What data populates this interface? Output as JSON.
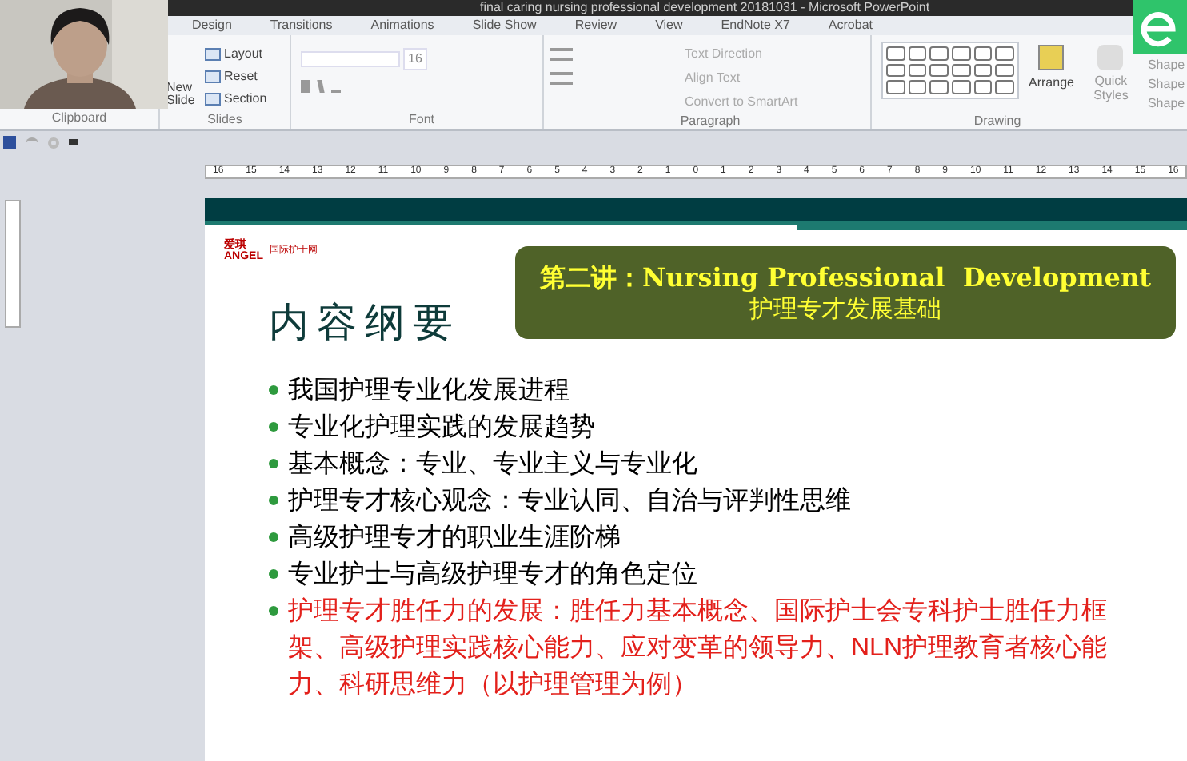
{
  "window": {
    "title": "final caring nursing professional development 20181031 - Microsoft PowerPoint"
  },
  "tabs": [
    {
      "label": "Design",
      "selected": false
    },
    {
      "label": "Transitions",
      "selected": false
    },
    {
      "label": "Animations",
      "selected": false
    },
    {
      "label": "Slide Show",
      "selected": false
    },
    {
      "label": "Review",
      "selected": false
    },
    {
      "label": "View",
      "selected": false
    },
    {
      "label": "EndNote X7",
      "selected": false
    },
    {
      "label": "Acrobat",
      "selected": false
    }
  ],
  "ribbon": {
    "groups": [
      "Clipboard",
      "Slides",
      "Font",
      "Paragraph",
      "Drawing"
    ],
    "slides_buttons": [
      "New Slide",
      "Layout",
      "Reset",
      "Section"
    ],
    "font_size": "16",
    "paragraph_buttons": [
      "Text Direction",
      "Align Text",
      "Convert to SmartArt"
    ],
    "drawing_buttons": [
      "Arrange",
      "Quick Styles",
      "Shape",
      "Shape",
      "Shape"
    ]
  },
  "ruler": [
    "16",
    "15",
    "14",
    "13",
    "12",
    "11",
    "10",
    "9",
    "8",
    "7",
    "6",
    "5",
    "4",
    "3",
    "2",
    "1",
    "0",
    "1",
    "2",
    "3",
    "4",
    "5",
    "6",
    "7",
    "8",
    "9",
    "10",
    "11",
    "12",
    "13",
    "14",
    "15",
    "16"
  ],
  "slide": {
    "logos": [
      "爱琪",
      "ANGEL",
      "国际护士网"
    ],
    "banner": {
      "line1": "第二讲：Nursing Professional  Development",
      "line2": "护理专才发展基础"
    },
    "heading": "内容纲要",
    "bullets": [
      {
        "text": "我国护理专业化发展进程",
        "highlight": false
      },
      {
        "text": "专业化护理实践的发展趋势",
        "highlight": false
      },
      {
        "text": "基本概念：专业、专业主义与专业化",
        "highlight": false
      },
      {
        "text": "护理专才核心观念：专业认同、自治与评判性思维",
        "highlight": false
      },
      {
        "text": "高级护理专才的职业生涯阶梯",
        "highlight": false
      },
      {
        "text": "专业护士与高级护理专才的角色定位",
        "highlight": false
      },
      {
        "text": "护理专才胜任力的发展：胜任力基本概念、国际护士会专科护士胜任力框架、高级护理实践核心能力、应对变革的领导力、NLN护理教育者核心能力、科研思维力（以护理管理为例）",
        "highlight": true
      }
    ]
  }
}
